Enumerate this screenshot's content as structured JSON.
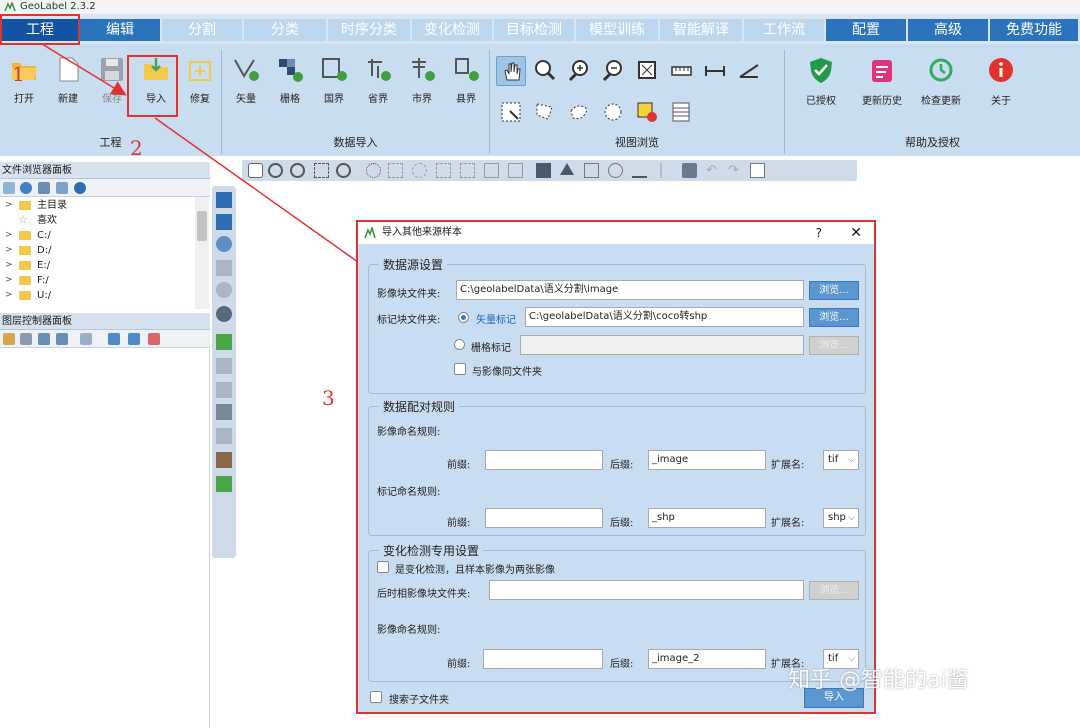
{
  "app": {
    "title": "GeoLabel 2.3.2"
  },
  "menu": {
    "tabs": [
      {
        "label": "工程"
      },
      {
        "label": "编辑"
      },
      {
        "label": "分割"
      },
      {
        "label": "分类"
      },
      {
        "label": "时序分类"
      },
      {
        "label": "变化检测"
      },
      {
        "label": "目标检测"
      },
      {
        "label": "模型训练"
      },
      {
        "label": "智能解译"
      },
      {
        "label": "工作流"
      },
      {
        "label": "配置"
      },
      {
        "label": "高级"
      },
      {
        "label": "免费功能"
      }
    ]
  },
  "ribbon": {
    "project": {
      "label": "工程",
      "buttons": [
        "打开",
        "新建",
        "保存",
        "导入",
        "修复"
      ]
    },
    "data_import": {
      "label": "数据导入",
      "buttons": [
        "矢量",
        "栅格",
        "国界",
        "省界",
        "市界",
        "县界"
      ]
    },
    "view": {
      "label": "视图浏览"
    },
    "help": {
      "label": "帮助及授权",
      "buttons": [
        "已授权",
        "更新历史",
        "检查更新",
        "关于"
      ]
    }
  },
  "file_browser": {
    "title": "文件浏览器面板",
    "items": [
      {
        "label": "主目录"
      },
      {
        "label": "喜欢"
      },
      {
        "label": "C:/"
      },
      {
        "label": "D:/"
      },
      {
        "label": "E:/"
      },
      {
        "label": "F:/"
      },
      {
        "label": "U:/"
      }
    ]
  },
  "layer_panel": {
    "title": "图层控制器面板"
  },
  "dialog": {
    "title": "导入其他来源样本",
    "help": "?",
    "close": "✕",
    "source": {
      "title": "数据源设置",
      "image_folder_label": "影像块文件夹:",
      "image_folder_value": "C:\\geolabelData\\语义分割\\image",
      "label_folder_label": "标记块文件夹:",
      "vector_label": "矢量标记",
      "vector_value": "C:\\geolabelData\\语义分割\\coco转shp",
      "raster_label": "栅格标记",
      "same_folder_label": "与影像同文件夹",
      "browse": "浏览..."
    },
    "pairing": {
      "title": "数据配对规则",
      "image_rule_label": "影像命名规则:",
      "label_rule_label": "标记命名规则:",
      "prefix": "前缀:",
      "suffix": "后缀:",
      "ext": "扩展名:",
      "image_suffix": "_image",
      "image_ext": "tif",
      "label_suffix": "_shp",
      "label_ext": "shp"
    },
    "change": {
      "title": "变化检测专用设置",
      "checkbox_label": "是变化检测，且样本影像为两张影像",
      "later_folder_label": "后时相影像块文件夹:",
      "image_rule_label": "影像命名规则:",
      "suffix_value": "_image_2",
      "ext_value": "tif"
    },
    "search_sub": "搜索子文件夹",
    "ok": "导入"
  },
  "annotations": {
    "n1": "1",
    "n2": "2",
    "n3": "3"
  },
  "watermark": "知乎 @智能的ai酱",
  "colors": {
    "accent": "#e0322f",
    "menu_active": "#1254a2",
    "ribbon_bg": "#c8ddf0"
  }
}
